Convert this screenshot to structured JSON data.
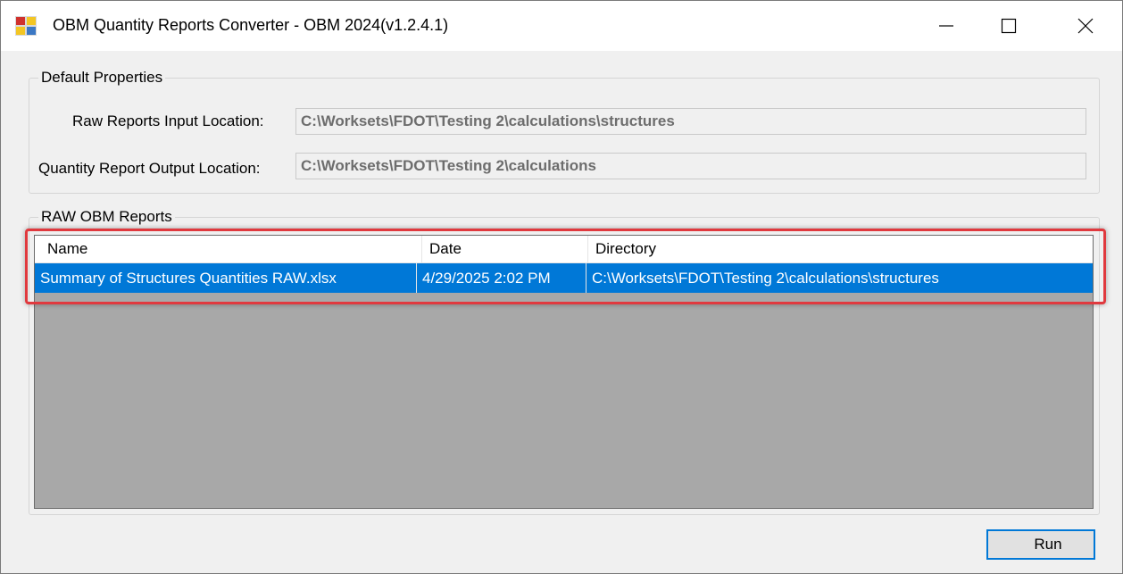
{
  "window": {
    "title": "OBM Quantity Reports Converter - OBM 2024(v1.2.4.1)",
    "controls": {
      "minimize": "minimize-icon",
      "maximize": "maximize-icon",
      "close": "close-icon"
    }
  },
  "default_properties": {
    "group_label": "Default Properties",
    "raw_input_label": "Raw Reports Input Location:",
    "raw_input_value": "C:\\Worksets\\FDOT\\Testing 2\\calculations\\structures",
    "output_label": "Quantity Report Output Location:",
    "output_value": "C:\\Worksets\\FDOT\\Testing 2\\calculations"
  },
  "reports": {
    "group_label": "RAW OBM Reports",
    "columns": [
      "Name",
      "Date",
      "Directory"
    ],
    "rows": [
      {
        "name": "Summary of Structures Quantities RAW.xlsx",
        "date": "4/29/2025 2:02 PM",
        "directory": "C:\\Worksets\\FDOT\\Testing 2\\calculations\\structures",
        "selected": true
      }
    ]
  },
  "actions": {
    "run_label": "Run"
  },
  "colors": {
    "selection": "#0078d7",
    "highlight_border": "#e0393e",
    "list_background": "#a8a8a8"
  }
}
